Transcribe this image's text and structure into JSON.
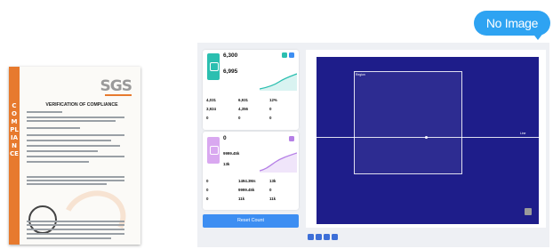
{
  "bubble": {
    "label": "No Image"
  },
  "certificate": {
    "logo": "SGS",
    "title": "VERIFICATION OF COMPLIANCE",
    "side_text": "COMPLIANCE"
  },
  "panel": {
    "card1": {
      "primary_value": "6,300",
      "secondary_value": "6,995",
      "stats": [
        {
          "value": "4,031",
          "label": ""
        },
        {
          "value": "6,931",
          "label": ""
        },
        {
          "value": "12%",
          "label": ""
        },
        {
          "value": "3,924",
          "label": ""
        },
        {
          "value": "4,356",
          "label": ""
        },
        {
          "value": "0",
          "label": ""
        },
        {
          "value": "0",
          "label": ""
        },
        {
          "value": "0",
          "label": ""
        },
        {
          "value": "0",
          "label": ""
        }
      ]
    },
    "card2": {
      "primary_value": "0",
      "secondary_value": "9999.45k",
      "tertiary_value": "13k",
      "stats": [
        {
          "value": "0",
          "label": ""
        },
        {
          "value": "1494.3Ms",
          "label": ""
        },
        {
          "value": "13k",
          "label": ""
        },
        {
          "value": "0",
          "label": ""
        },
        {
          "value": "9999.45k",
          "label": ""
        },
        {
          "value": "0",
          "label": ""
        },
        {
          "value": "0",
          "label": ""
        },
        {
          "value": "11k",
          "label": ""
        },
        {
          "value": "11k",
          "label": ""
        }
      ]
    },
    "reset_label": "Reset Count"
  },
  "viewer": {
    "roi_label": "Region",
    "line_label": "Line"
  },
  "colors": {
    "accent": "#3d8ef2",
    "canvas_bg": "#1e1d8a",
    "card1_icon": "#2bbfb0",
    "card2_icon": "#d9a8f0",
    "bubble": "#2ea3f2",
    "cert_band": "#e77a2e"
  },
  "icons": [
    "image-icon",
    "chart-icon",
    "zoom-icon",
    "pan-icon",
    "fit-icon",
    "settings-icon"
  ]
}
